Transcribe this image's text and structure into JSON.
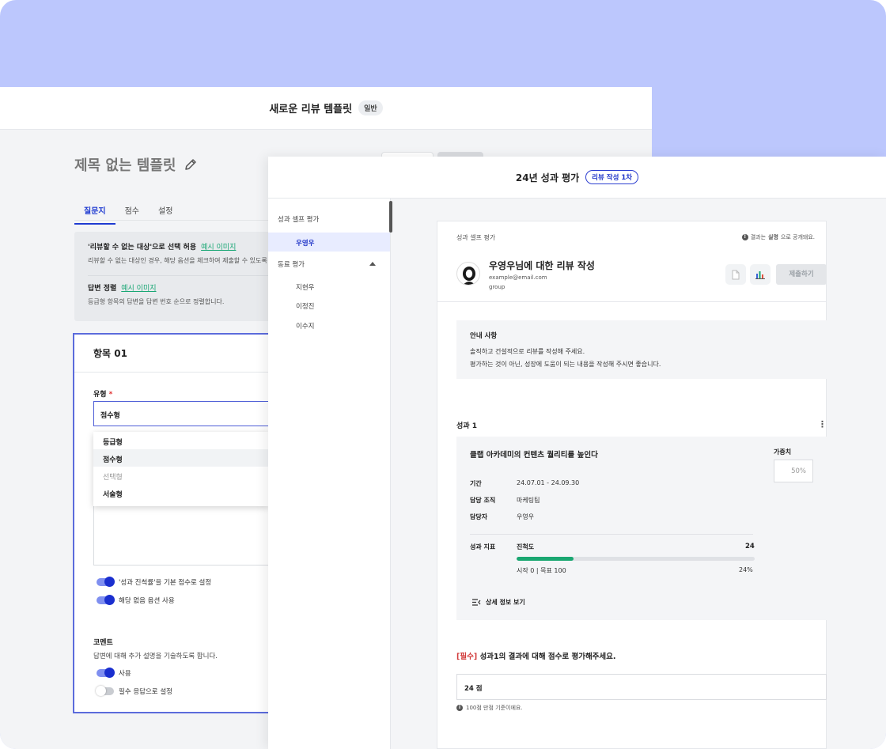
{
  "back_window": {
    "header_title": "새로운 리뷰 템플릿",
    "header_badge": "일반",
    "template_title": "제목 없는 템플릿",
    "tabs": [
      {
        "label": "질문지",
        "active": true
      },
      {
        "label": "점수",
        "active": false
      },
      {
        "label": "설정",
        "active": false
      }
    ],
    "info": {
      "row1_title": "'리뷰할 수 없는 대상'으로 선택 허용",
      "row1_link": "예시 이미지",
      "row1_desc": "리뷰할 수 없는 대상인 경우, 해당 옵션을 체크하여 제출할 수 있도록",
      "row2_title": "답변 정렬",
      "row2_link": "예시 이미지",
      "row2_desc": "등급형 항목의 답변을 답변 번호 순으로 정렬합니다."
    },
    "item": {
      "title": "항목 01",
      "type_label": "유형",
      "required_mark": "*",
      "selected_type": "점수형",
      "dropdown_options": [
        {
          "label": "등급형",
          "state": "normal"
        },
        {
          "label": "점수형",
          "state": "highlighted"
        },
        {
          "label": "선택형",
          "state": "disabled"
        },
        {
          "label": "서술형",
          "state": "normal"
        }
      ],
      "toggle_default_score": "'성과 진척률'을 기본 점수로 설정",
      "toggle_na_option": "해당 없음 옵션 사용",
      "comment_title": "코멘트",
      "comment_desc": "답변에 대해 추가 설명을 기술하도록 합니다.",
      "toggle_use": "사용",
      "toggle_required": "필수 응답으로 설정"
    }
  },
  "front_window": {
    "header_title": "24년 성과 평가",
    "header_badge": "리뷰 작성 1차",
    "sidebar": {
      "self_section": "성과 셀프 평가",
      "self_items": [
        {
          "label": "우영우",
          "active": true
        }
      ],
      "peer_section": "동료 평가",
      "peer_items": [
        {
          "label": "지현우"
        },
        {
          "label": "이정진"
        },
        {
          "label": "이수지"
        }
      ]
    },
    "panel": {
      "section_label": "성과 셀프 평가",
      "notice_prefix": "결과는",
      "notice_bold": "실명",
      "notice_suffix": "으로 공개돼요.",
      "reviewee_title": "우영우님에 대한 리뷰 작성",
      "email": "example@email.com",
      "group": "group",
      "submit_label": "제출하기",
      "guide_title": "안내 사항",
      "guide_lines": [
        "솔직하고 건설적으로 리뷰를 작성해 주세요.",
        "평가하는 것이 아닌, 성장에 도움이 되는 내용을 작성해 주시면 좋습니다."
      ],
      "achievement_heading": "성과 1",
      "achievement": {
        "title": "클랩 아카데미의 컨텐츠 퀄리티를 높인다",
        "period_label": "기간",
        "period_value": "24.07.01 - 24.09.30",
        "org_label": "담당 조직",
        "org_value": "마케팅팀",
        "owner_label": "담당자",
        "owner_value": "우영우",
        "metric_label": "성과 지표",
        "metric_name": "진척도",
        "metric_value": "24",
        "progress_fraction": 0.24,
        "progress_range": "시작 0 | 목표 100",
        "progress_pct": "24%",
        "detail_link": "상세 정보 보기",
        "weight_label": "가중치",
        "weight_value": "50%"
      },
      "question_tag": "[필수]",
      "question_text": "성과1의 결과에 대해 점수로 평가해주세요.",
      "answer_value": "24 점",
      "answer_hint": "100점 만점 기준이에요."
    }
  },
  "colors": {
    "background": "#bcc7fd",
    "accent": "#1f3bd1",
    "progress": "#1aa771",
    "required": "#d23b3b"
  }
}
